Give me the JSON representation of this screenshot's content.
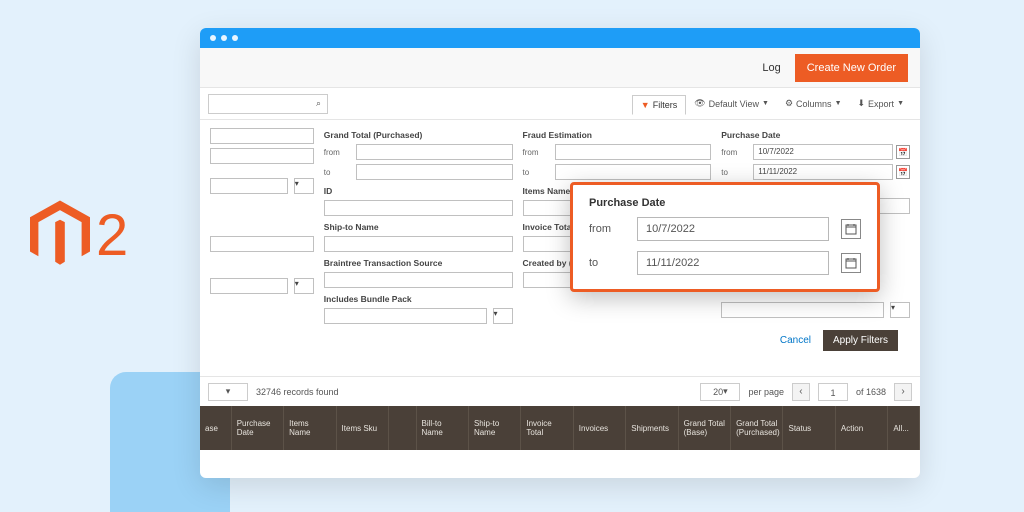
{
  "brand": {
    "name": "Magento",
    "version": "2"
  },
  "topbar": {
    "log": "Log",
    "create": "Create New Order"
  },
  "toolbar": {
    "filters": "Filters",
    "default_view": "Default View",
    "columns": "Columns",
    "export": "Export"
  },
  "filters": {
    "grand_total_purchased": {
      "label": "Grand Total (Purchased)",
      "from": "from",
      "to": "to"
    },
    "fraud": {
      "label": "Fraud Estimation",
      "from": "from",
      "to": "to"
    },
    "purchase_date": {
      "label": "Purchase Date",
      "from": "from",
      "to": "to",
      "from_val": "10/7/2022",
      "to_val": "11/11/2022"
    },
    "id": {
      "label": "ID"
    },
    "items_name": {
      "label": "Items Name"
    },
    "ship_to": {
      "label": "Ship-to Name"
    },
    "invoice_total": {
      "label": "Invoice Total"
    },
    "braintree": {
      "label": "Braintree Transaction Source"
    },
    "created_by": {
      "label": "Created by (L...)"
    },
    "bundle": {
      "label": "Includes Bundle Pack"
    }
  },
  "callout": {
    "title": "Purchase Date",
    "from": "from",
    "to": "to",
    "from_val": "10/7/2022",
    "to_val": "11/11/2022"
  },
  "actions": {
    "cancel": "Cancel",
    "apply": "Apply Filters"
  },
  "pager": {
    "records": "32746 records found",
    "per_page": "20",
    "per_page_label": "per page",
    "page": "1",
    "total": "of 1638"
  },
  "columns": [
    "ase",
    "Purchase Date",
    "Items Name",
    "Items Sku",
    "",
    "Bill-to Name",
    "Ship-to Name",
    "Invoice Total",
    "Invoices",
    "Shipments",
    "Grand Total (Base)",
    "Grand Total (Purchased)",
    "Status",
    "Action",
    "All..."
  ]
}
